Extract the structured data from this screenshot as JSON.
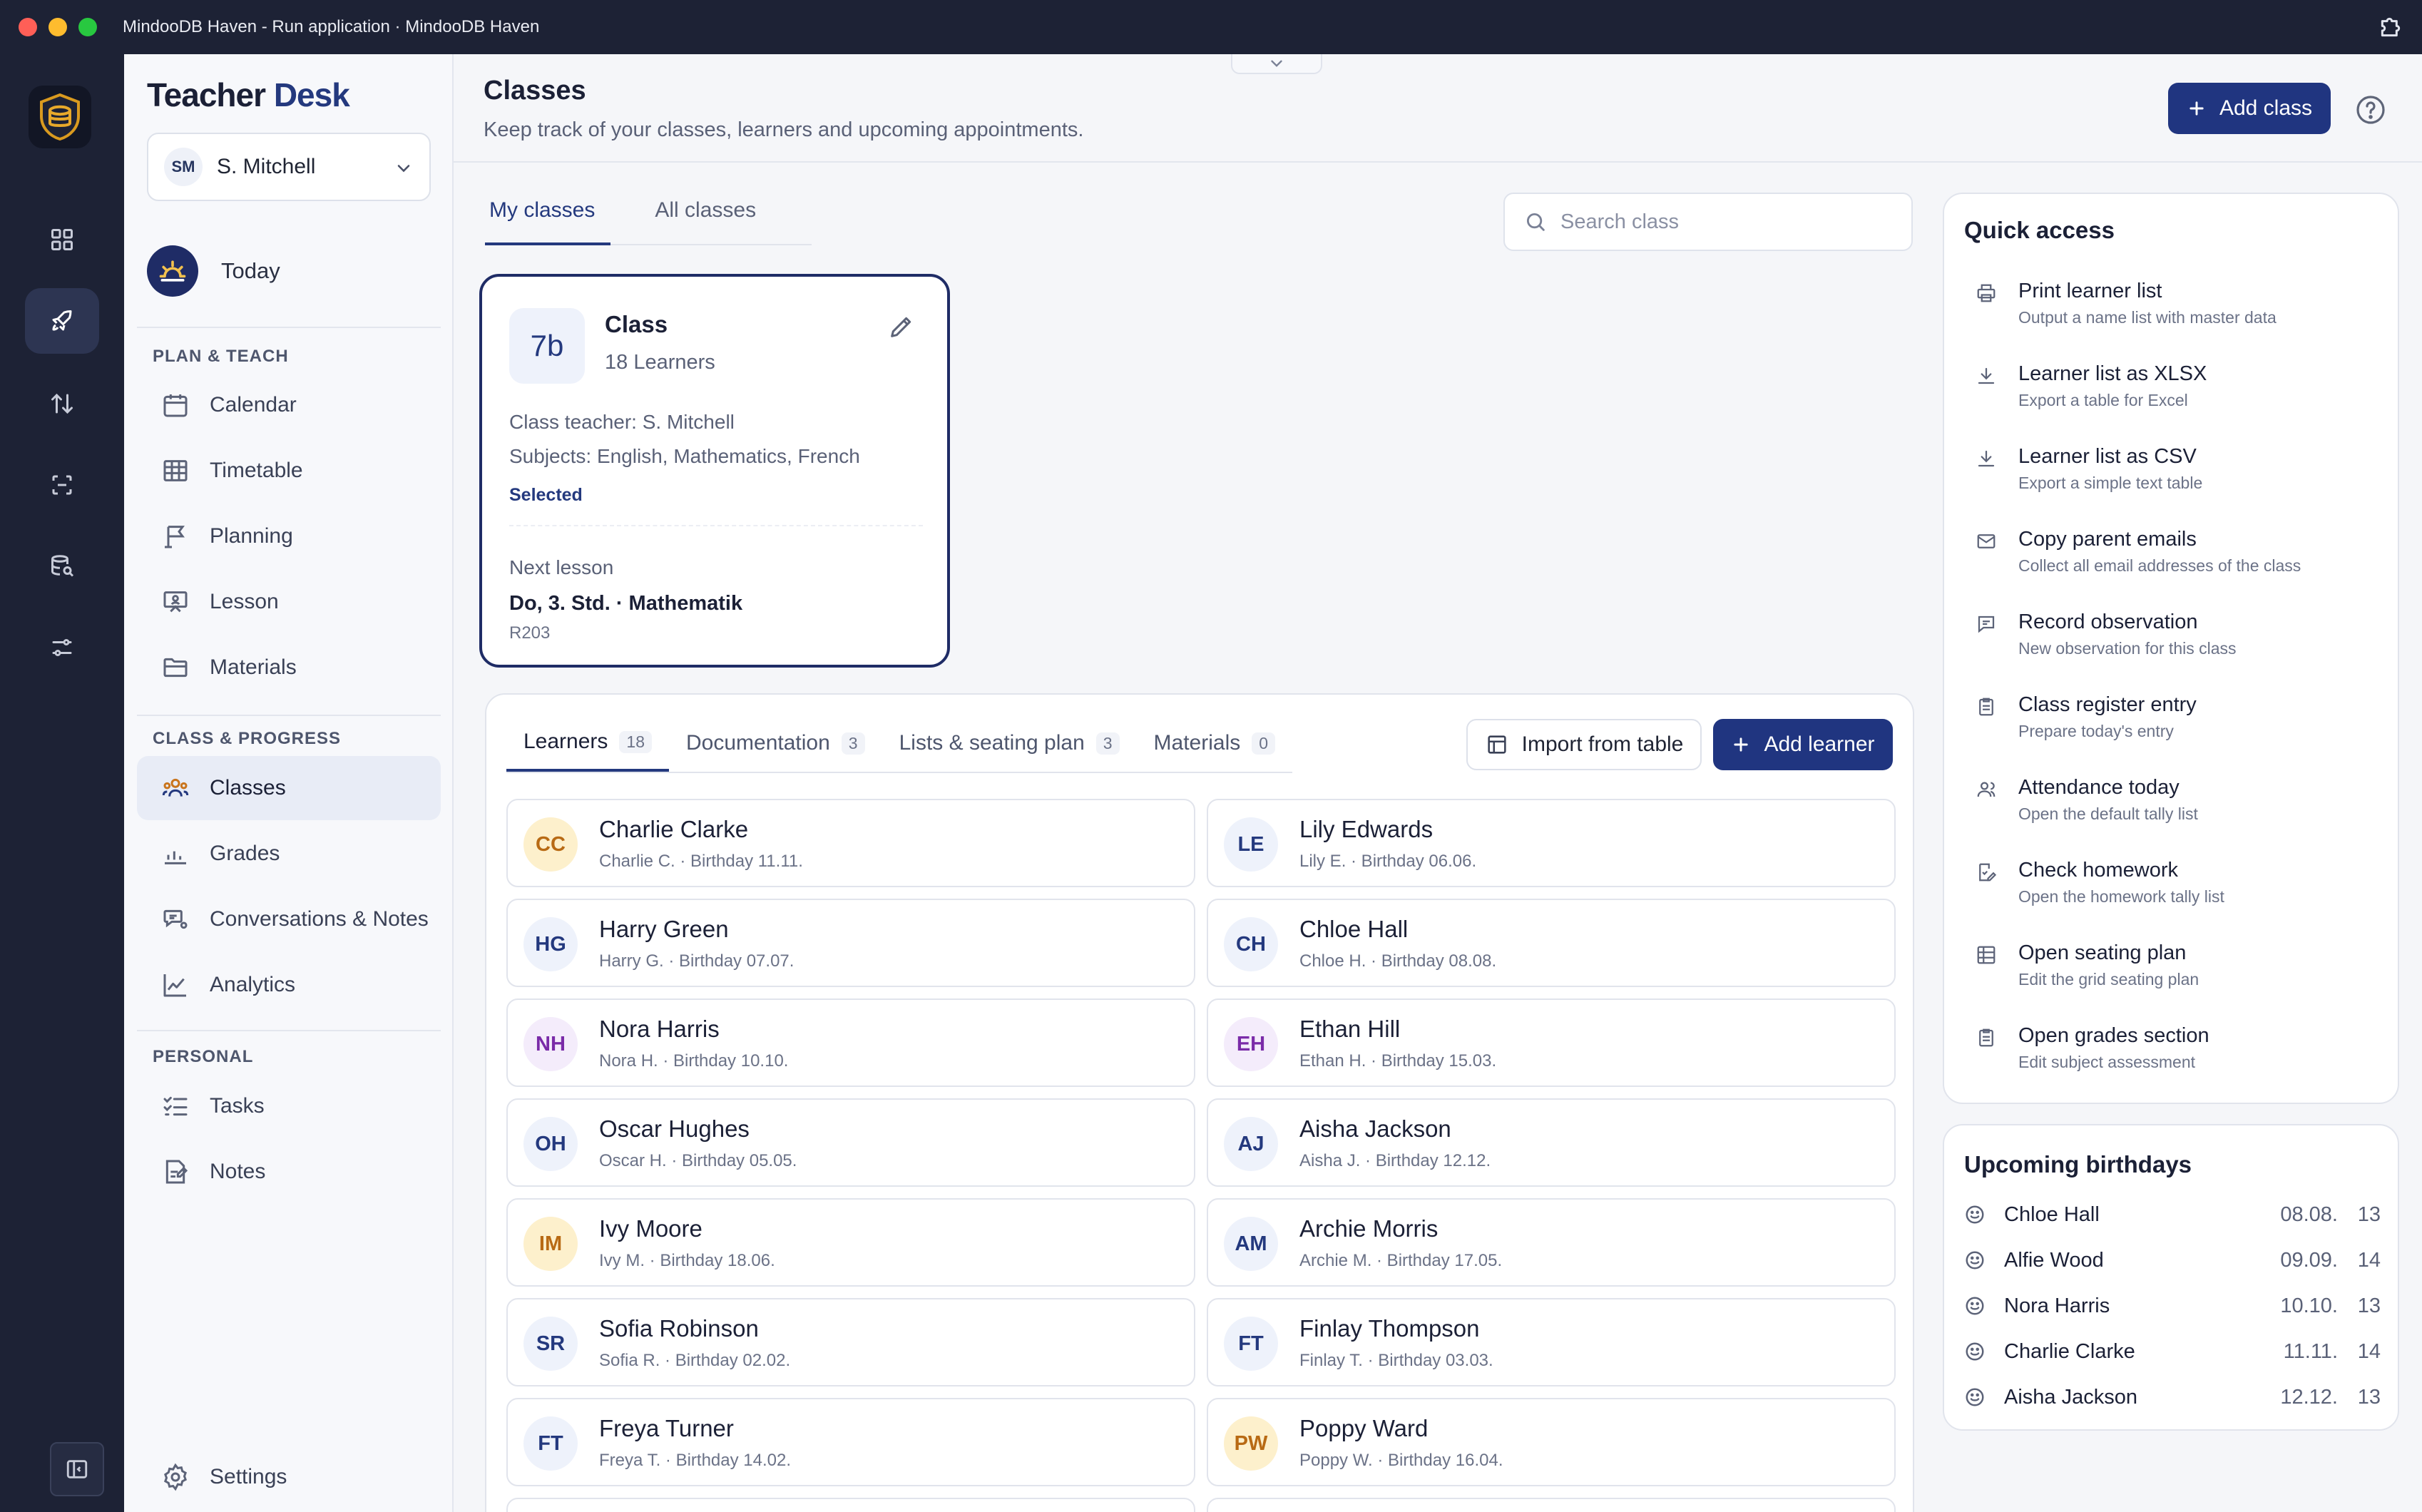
{
  "window": {
    "title": "MindooDB Haven - Run application · MindooDB Haven"
  },
  "brand": {
    "part1": "Teacher",
    "part2": "Desk"
  },
  "user": {
    "initials": "SM",
    "name": "S. Mitchell"
  },
  "nav": {
    "today": "Today",
    "sections": {
      "plan": "PLAN & TEACH",
      "class": "CLASS & PROGRESS",
      "personal": "PERSONAL"
    },
    "items": {
      "calendar": "Calendar",
      "timetable": "Timetable",
      "planning": "Planning",
      "lesson": "Lesson",
      "materials": "Materials",
      "classes": "Classes",
      "grades": "Grades",
      "conversations": "Conversations & Notes",
      "analytics": "Analytics",
      "tasks": "Tasks",
      "notes": "Notes",
      "settings": "Settings"
    }
  },
  "page": {
    "title": "Classes",
    "subtitle": "Keep track of your classes, learners and upcoming appointments.",
    "add_class": "Add class",
    "tabs": {
      "my": "My classes",
      "all": "All classes"
    },
    "search_placeholder": "Search class"
  },
  "class_card": {
    "badge": "7b",
    "name": "Class",
    "learners": "18 Learners",
    "teacher": "Class teacher: S. Mitchell",
    "subjects": "Subjects: English, Mathematics, French",
    "status": "Selected",
    "next_lesson_label": "Next lesson",
    "next_lesson": "Do, 3. Std. · Mathematik",
    "room": "R203"
  },
  "learner_tabs": [
    {
      "label": "Learners",
      "count": "18"
    },
    {
      "label": "Documentation",
      "count": "3"
    },
    {
      "label": "Lists & seating plan",
      "count": "3"
    },
    {
      "label": "Materials",
      "count": "0"
    }
  ],
  "learner_actions": {
    "import": "Import from table",
    "add": "Add learner"
  },
  "learners": [
    {
      "initials": "CC",
      "name": "Charlie Clarke",
      "sub": "Charlie C. · Birthday 11.11.",
      "bg": "#fdf0cc",
      "fg": "#b86a14"
    },
    {
      "initials": "LE",
      "name": "Lily Edwards",
      "sub": "Lily E. · Birthday 06.06.",
      "bg": "#eef2fb",
      "fg": "#24397e"
    },
    {
      "initials": "HG",
      "name": "Harry Green",
      "sub": "Harry G. · Birthday 07.07.",
      "bg": "#eef2fb",
      "fg": "#24397e"
    },
    {
      "initials": "CH",
      "name": "Chloe Hall",
      "sub": "Chloe H. · Birthday 08.08.",
      "bg": "#eef2fb",
      "fg": "#24397e"
    },
    {
      "initials": "NH",
      "name": "Nora Harris",
      "sub": "Nora H. · Birthday 10.10.",
      "bg": "#f4ecfb",
      "fg": "#7a2ba8"
    },
    {
      "initials": "EH",
      "name": "Ethan Hill",
      "sub": "Ethan H. · Birthday 15.03.",
      "bg": "#f4ecfb",
      "fg": "#7a2ba8"
    },
    {
      "initials": "OH",
      "name": "Oscar Hughes",
      "sub": "Oscar H. · Birthday 05.05.",
      "bg": "#eef2fb",
      "fg": "#24397e"
    },
    {
      "initials": "AJ",
      "name": "Aisha Jackson",
      "sub": "Aisha J. · Birthday 12.12.",
      "bg": "#eef2fb",
      "fg": "#24397e"
    },
    {
      "initials": "IM",
      "name": "Ivy Moore",
      "sub": "Ivy M. · Birthday 18.06.",
      "bg": "#fdf0cc",
      "fg": "#b86a14"
    },
    {
      "initials": "AM",
      "name": "Archie Morris",
      "sub": "Archie M. · Birthday 17.05.",
      "bg": "#eef2fb",
      "fg": "#24397e"
    },
    {
      "initials": "SR",
      "name": "Sofia Robinson",
      "sub": "Sofia R. · Birthday 02.02.",
      "bg": "#eef2fb",
      "fg": "#24397e"
    },
    {
      "initials": "FT",
      "name": "Finlay Thompson",
      "sub": "Finlay T. · Birthday 03.03.",
      "bg": "#eef2fb",
      "fg": "#24397e"
    },
    {
      "initials": "FT",
      "name": "Freya Turner",
      "sub": "Freya T. · Birthday 14.02.",
      "bg": "#eef2fb",
      "fg": "#24397e"
    },
    {
      "initials": "PW",
      "name": "Poppy Ward",
      "sub": "Poppy W. · Birthday 16.04.",
      "bg": "#fdf0cc",
      "fg": "#b86a14"
    }
  ],
  "quick_access": {
    "title": "Quick access",
    "items": [
      {
        "icon": "printer-icon",
        "title": "Print learner list",
        "sub": "Output a name list with master data"
      },
      {
        "icon": "download-icon",
        "title": "Learner list as XLSX",
        "sub": "Export a table for Excel"
      },
      {
        "icon": "download-icon",
        "title": "Learner list as CSV",
        "sub": "Export a simple text table"
      },
      {
        "icon": "mail-icon",
        "title": "Copy parent emails",
        "sub": "Collect all email addresses of the class"
      },
      {
        "icon": "message-icon",
        "title": "Record observation",
        "sub": "New observation for this class"
      },
      {
        "icon": "clipboard-icon",
        "title": "Class register entry",
        "sub": "Prepare today's entry"
      },
      {
        "icon": "users-icon",
        "title": "Attendance today",
        "sub": "Open the default tally list"
      },
      {
        "icon": "edit-check-icon",
        "title": "Check homework",
        "sub": "Open the homework tally list"
      },
      {
        "icon": "grid-icon",
        "title": "Open seating plan",
        "sub": "Edit the grid seating plan"
      },
      {
        "icon": "clipboard-icon",
        "title": "Open grades section",
        "sub": "Edit subject assessment"
      }
    ]
  },
  "birthdays": {
    "title": "Upcoming birthdays",
    "items": [
      {
        "name": "Chloe Hall",
        "date": "08.08.",
        "age": "13"
      },
      {
        "name": "Alfie Wood",
        "date": "09.09.",
        "age": "14"
      },
      {
        "name": "Nora Harris",
        "date": "10.10.",
        "age": "13"
      },
      {
        "name": "Charlie Clarke",
        "date": "11.11.",
        "age": "14"
      },
      {
        "name": "Aisha Jackson",
        "date": "12.12.",
        "age": "13"
      }
    ]
  },
  "colors": {
    "primary": "#203580",
    "sidebar_dark": "#1d2235",
    "accent": "#24397e"
  }
}
